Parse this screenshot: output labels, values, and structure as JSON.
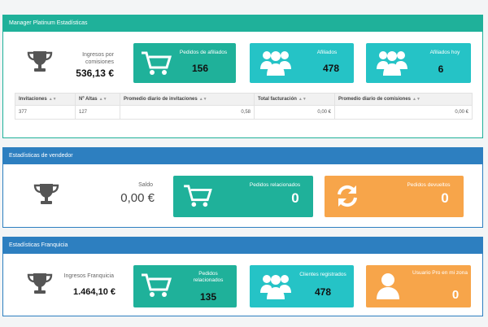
{
  "platinum": {
    "title": "Manager Platinum Estadísticas",
    "income_label": "Ingresos por comisiones",
    "income_value": "536,13 €",
    "cards": [
      {
        "title": "Pedidos de afiliados",
        "value": "156",
        "icon": "cart-icon"
      },
      {
        "title": "Afiliados",
        "value": "478",
        "icon": "users-icon"
      },
      {
        "title": "Afiliados hoy",
        "value": "6",
        "icon": "users-icon"
      }
    ],
    "table": {
      "headers": [
        "Invitaciones",
        "Nº Altas",
        "Promedio diario de invitaciones",
        "Total facturación",
        "Promedio diario de comisiones"
      ],
      "row": [
        "377",
        "127",
        "0,58",
        "0,00 €",
        "0,00 €"
      ]
    }
  },
  "vendor": {
    "title": "Estadísticas de vendedor",
    "income_label": "Saldo",
    "income_value": "0,00 €",
    "cards": [
      {
        "title": "Pedidos relacionados",
        "value": "0",
        "icon": "cart-icon"
      },
      {
        "title": "Pedidos devueltos",
        "value": "0",
        "icon": "refresh-icon"
      }
    ]
  },
  "franchise": {
    "title": "Estadísticas Franquicia",
    "income_label": "Ingresos Franquicia",
    "income_value": "1.464,10 €",
    "cards": [
      {
        "title": "Pedidos relacionados",
        "value": "135",
        "icon": "cart-icon"
      },
      {
        "title": "Clientes registrados",
        "value": "478",
        "icon": "users-icon"
      },
      {
        "title": "Usuario Pro en mi zona",
        "value": "0",
        "icon": "user-icon"
      }
    ]
  },
  "colors": {
    "green": "#1fb19a",
    "cyan": "#25c3c6",
    "orange": "#f7a54a",
    "blue": "#2d7fc0"
  }
}
